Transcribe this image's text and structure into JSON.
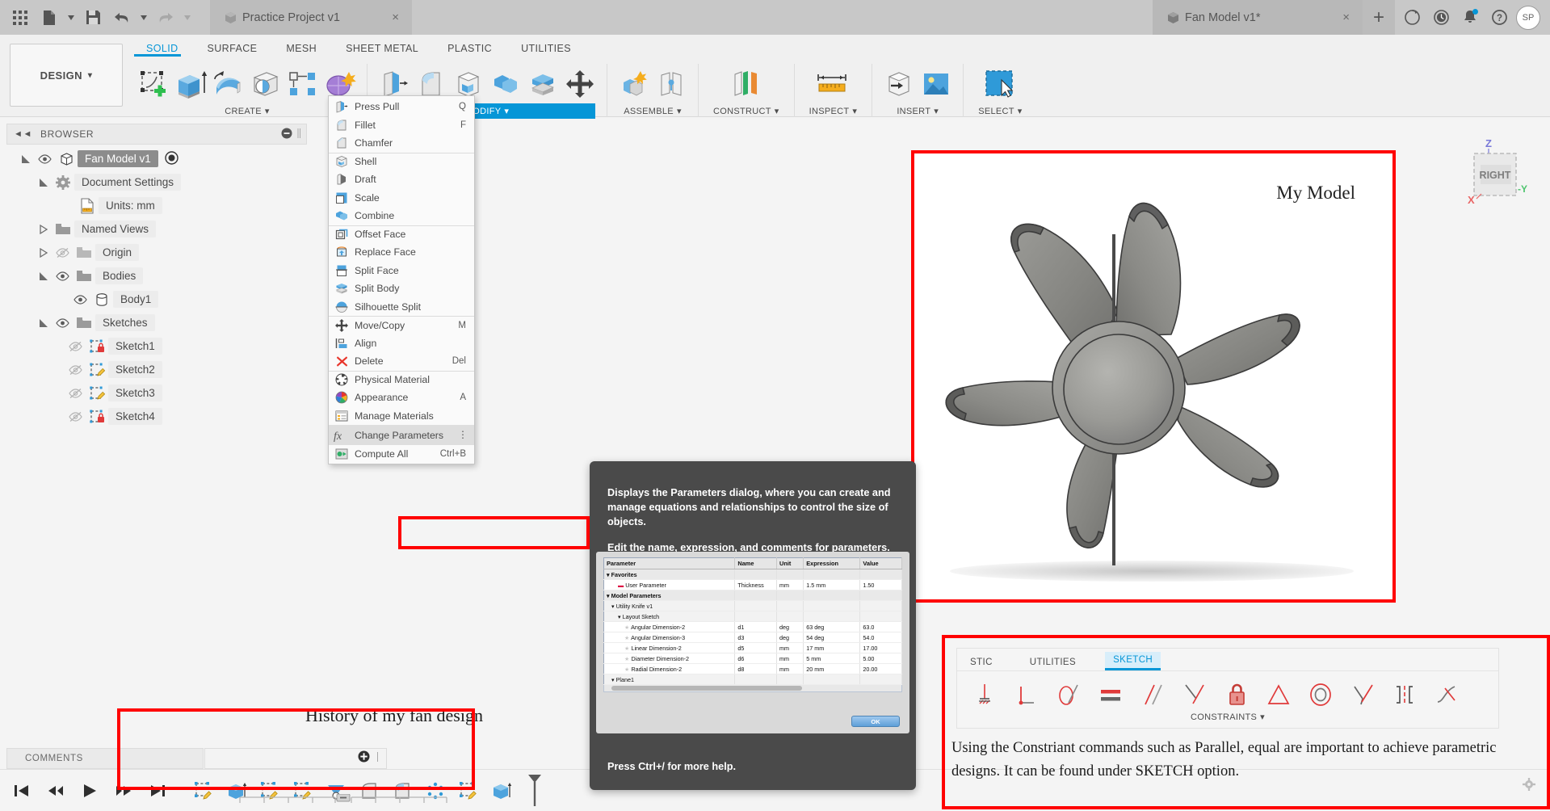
{
  "app": {
    "name": "Autodesk Fusion 360",
    "accent": "#0696d7",
    "annotation_color": "#ff0000"
  },
  "topbar": {
    "grid_icon": "grid-apps-icon",
    "new_icon": "new-file-icon",
    "save_icon": "save-icon",
    "undo_icon": "undo-icon",
    "redo_icon": "redo-icon",
    "tabs": [
      {
        "title": "Practice Project v1",
        "active": false,
        "close": "×"
      },
      {
        "title": "Fan Model v1*",
        "active": true,
        "close": "×"
      }
    ],
    "new_tab_label": "+",
    "right_icons": [
      "job-status-icon",
      "recent-icon",
      "notifications-icon",
      "help-icon"
    ],
    "avatar_initials": "SP"
  },
  "ribbon": {
    "design_dropdown": "DESIGN",
    "design_caret": "▾",
    "workspace_tabs": [
      {
        "label": "SOLID",
        "active": true
      },
      {
        "label": "SURFACE",
        "active": false
      },
      {
        "label": "MESH",
        "active": false
      },
      {
        "label": "SHEET METAL",
        "active": false
      },
      {
        "label": "PLASTIC",
        "active": false
      },
      {
        "label": "UTILITIES",
        "active": false
      }
    ],
    "panels": [
      {
        "label": "CREATE",
        "caret": "▾",
        "highlighted": false,
        "icons": [
          "create-sketch-icon",
          "extrude-icon",
          "revolve-icon",
          "hole-icon",
          "pattern-icon",
          "form-icon"
        ]
      },
      {
        "label": "MODIFY",
        "caret": "▾",
        "highlighted": true,
        "icons": [
          "press-pull-icon",
          "fillet-icon",
          "shell-icon",
          "combine-icon",
          "split-body-icon",
          "move-copy-icon"
        ]
      },
      {
        "label": "ASSEMBLE",
        "caret": "▾",
        "highlighted": false,
        "icons": [
          "new-component-icon",
          "joint-icon"
        ]
      },
      {
        "label": "CONSTRUCT",
        "caret": "▾",
        "highlighted": false,
        "icons": [
          "offset-plane-icon"
        ]
      },
      {
        "label": "INSPECT",
        "caret": "▾",
        "highlighted": false,
        "icons": [
          "measure-icon"
        ]
      },
      {
        "label": "INSERT",
        "caret": "▾",
        "highlighted": false,
        "icons": [
          "insert-derive-icon",
          "canvas-image-icon"
        ]
      },
      {
        "label": "SELECT",
        "caret": "▾",
        "highlighted": false,
        "icons": [
          "window-select-icon"
        ]
      }
    ]
  },
  "browser": {
    "title": "BROWSER",
    "collapse_icon": "collapse-left-icon",
    "tree": [
      {
        "label": "Fan Model v1",
        "indent": 0,
        "arrow": "expanded",
        "eye": "visible",
        "icon": "component-icon",
        "selected": true,
        "trailing": "activate-radio-icon"
      },
      {
        "label": "Document Settings",
        "indent": 1,
        "arrow": "expanded",
        "eye": "none",
        "icon": "gear-icon",
        "selected": false
      },
      {
        "label": "Units: mm",
        "indent": 2,
        "arrow": "none",
        "eye": "none",
        "icon": "units-icon",
        "selected": false
      },
      {
        "label": "Named Views",
        "indent": 1,
        "arrow": "collapsed",
        "eye": "none",
        "icon": "folder-icon",
        "selected": false
      },
      {
        "label": "Origin",
        "indent": 1,
        "arrow": "collapsed",
        "eye": "hidden",
        "icon": "folder-icon",
        "selected": false
      },
      {
        "label": "Bodies",
        "indent": 1,
        "arrow": "expanded",
        "eye": "visible",
        "icon": "folder-icon",
        "selected": false
      },
      {
        "label": "Body1",
        "indent": 2,
        "arrow": "none",
        "eye": "visible",
        "icon": "body-icon",
        "selected": false
      },
      {
        "label": "Sketches",
        "indent": 1,
        "arrow": "expanded",
        "eye": "visible",
        "icon": "folder-icon",
        "selected": false
      },
      {
        "label": "Sketch1",
        "indent": 2,
        "arrow": "none",
        "eye": "hidden",
        "icon": "sketch-locked-icon",
        "selected": false
      },
      {
        "label": "Sketch2",
        "indent": 2,
        "arrow": "none",
        "eye": "hidden",
        "icon": "sketch-icon",
        "selected": false
      },
      {
        "label": "Sketch3",
        "indent": 2,
        "arrow": "none",
        "eye": "hidden",
        "icon": "sketch-icon",
        "selected": false
      },
      {
        "label": "Sketch4",
        "indent": 2,
        "arrow": "none",
        "eye": "hidden",
        "icon": "sketch-locked-icon",
        "selected": false
      }
    ]
  },
  "modify_menu": {
    "items": [
      {
        "label": "Press Pull",
        "shortcut": "Q",
        "icon": "press-pull-icon",
        "separator": false
      },
      {
        "label": "Fillet",
        "shortcut": "F",
        "icon": "fillet-icon",
        "separator": false
      },
      {
        "label": "Chamfer",
        "shortcut": "",
        "icon": "chamfer-icon",
        "separator": false
      },
      {
        "label": "Shell",
        "shortcut": "",
        "icon": "shell-icon",
        "separator": true
      },
      {
        "label": "Draft",
        "shortcut": "",
        "icon": "draft-icon",
        "separator": false
      },
      {
        "label": "Scale",
        "shortcut": "",
        "icon": "scale-icon",
        "separator": false
      },
      {
        "label": "Combine",
        "shortcut": "",
        "icon": "combine-icon",
        "separator": false
      },
      {
        "label": "Offset Face",
        "shortcut": "",
        "icon": "offset-face-icon",
        "separator": true
      },
      {
        "label": "Replace Face",
        "shortcut": "",
        "icon": "replace-face-icon",
        "separator": false
      },
      {
        "label": "Split Face",
        "shortcut": "",
        "icon": "split-face-icon",
        "separator": false
      },
      {
        "label": "Split Body",
        "shortcut": "",
        "icon": "split-body-icon",
        "separator": false
      },
      {
        "label": "Silhouette Split",
        "shortcut": "",
        "icon": "silhouette-split-icon",
        "separator": false
      },
      {
        "label": "Move/Copy",
        "shortcut": "M",
        "icon": "move-copy-icon",
        "separator": true
      },
      {
        "label": "Align",
        "shortcut": "",
        "icon": "align-icon",
        "separator": false
      },
      {
        "label": "Delete",
        "shortcut": "Del",
        "icon": "delete-icon",
        "separator": false
      },
      {
        "label": "Physical Material",
        "shortcut": "",
        "icon": "physical-material-icon",
        "separator": true
      },
      {
        "label": "Appearance",
        "shortcut": "A",
        "icon": "appearance-icon",
        "separator": false
      },
      {
        "label": "Manage Materials",
        "shortcut": "",
        "icon": "manage-materials-icon",
        "separator": false
      },
      {
        "label": "Change Parameters",
        "shortcut": "",
        "icon": "fx-icon",
        "separator": false,
        "highlighted": true,
        "overflow": "⋮"
      },
      {
        "label": "Compute All",
        "shortcut": "Ctrl+B",
        "icon": "compute-all-icon",
        "separator": false
      }
    ]
  },
  "tooltip": {
    "paragraph1": "Displays the Parameters dialog, where you can create and manage equations and relationships to control the size of objects.",
    "paragraph2": "Edit the name, expression, and comments for parameters. Create User Parameters to use in other expressions.",
    "footer": "Press Ctrl+/ for more help.",
    "dialog": {
      "headers": [
        "Parameter",
        "Name",
        "Unit",
        "Expression",
        "Value"
      ],
      "rows": [
        {
          "cells": [
            "Favorites",
            "",
            "",
            "",
            ""
          ],
          "indent": 0,
          "group": true,
          "caret": "▾"
        },
        {
          "cells": [
            "User Parameter",
            "Thickness",
            "mm",
            "1.5 mm",
            "1.50"
          ],
          "indent": 2,
          "marker": "dash"
        },
        {
          "cells": [
            "Model Parameters",
            "",
            "",
            "",
            ""
          ],
          "indent": 0,
          "group": true,
          "caret": "▾"
        },
        {
          "cells": [
            "Utility Knife v1",
            "",
            "",
            "",
            ""
          ],
          "indent": 1,
          "group2": true,
          "caret": "▾"
        },
        {
          "cells": [
            "Layout Sketch",
            "",
            "",
            "",
            ""
          ],
          "indent": 2,
          "group2": true,
          "caret": "▾"
        },
        {
          "cells": [
            "Angular Dimension-2",
            "d1",
            "deg",
            "63 deg",
            "63.0"
          ],
          "indent": 3,
          "marker": "star"
        },
        {
          "cells": [
            "Angular Dimension-3",
            "d3",
            "deg",
            "54 deg",
            "54.0"
          ],
          "indent": 3,
          "marker": "star"
        },
        {
          "cells": [
            "Linear Dimension-2",
            "d5",
            "mm",
            "17 mm",
            "17.00"
          ],
          "indent": 3,
          "marker": "star"
        },
        {
          "cells": [
            "Diameter Dimension-2",
            "d6",
            "mm",
            "5 mm",
            "5.00"
          ],
          "indent": 3,
          "marker": "star"
        },
        {
          "cells": [
            "Radial Dimension-2",
            "d8",
            "mm",
            "20 mm",
            "20.00"
          ],
          "indent": 3,
          "marker": "star"
        },
        {
          "cells": [
            "Plane1",
            "",
            "",
            "",
            ""
          ],
          "indent": 1,
          "group2": true,
          "caret": "▾"
        }
      ],
      "ok_button": "OK"
    }
  },
  "canvas": {
    "model_annotation": "My Model",
    "viewcube": {
      "face_label": "RIGHT",
      "axis_z": "Z",
      "axis_y": "-Y",
      "axis_x": "X"
    }
  },
  "sketch_callout": {
    "tabs": [
      {
        "label": "STIC",
        "active": false
      },
      {
        "label": "UTILITIES",
        "active": false
      },
      {
        "label": "SKETCH",
        "active": true
      }
    ],
    "panel_label": "CONSTRAINTS",
    "panel_caret": "▾",
    "icons": [
      "horizontal-vertical-constraint-icon",
      "perpendicular-constraint-icon",
      "tangent-constraint-icon",
      "equal-constraint-icon",
      "parallel-constraint-icon",
      "midpoint-constraint-icon",
      "fix-unfix-constraint-icon",
      "symmetry-constraint-icon",
      "concentric-constraint-icon",
      "collinear-constraint-icon",
      "curvature-constraint-icon",
      "coincident-constraint-icon"
    ],
    "note": "Using the Constriant commands such as Parallel, equal are important to achieve parametric designs. It can be found under SKETCH option."
  },
  "bottom": {
    "comments_label": "COMMENTS",
    "timeline_add_icon": "add-timeline-marker-icon",
    "history_note": "History of my fan design",
    "playback": [
      "jump-start-icon",
      "step-back-icon",
      "play-icon",
      "step-forward-icon",
      "jump-end-icon"
    ],
    "timeline_items": [
      "sketch-feature-icon",
      "extrude-feature-icon",
      "sketch-feature-icon",
      "sketch-feature-icon",
      "revolve-feature-icon",
      "fillet-feature-icon",
      "fillet-feature-icon",
      "pattern-feature-icon",
      "sketch-feature-icon",
      "extrude-feature-icon"
    ],
    "end_marker_icon": "timeline-end-marker-icon",
    "settings_icon": "settings-gear-icon"
  }
}
